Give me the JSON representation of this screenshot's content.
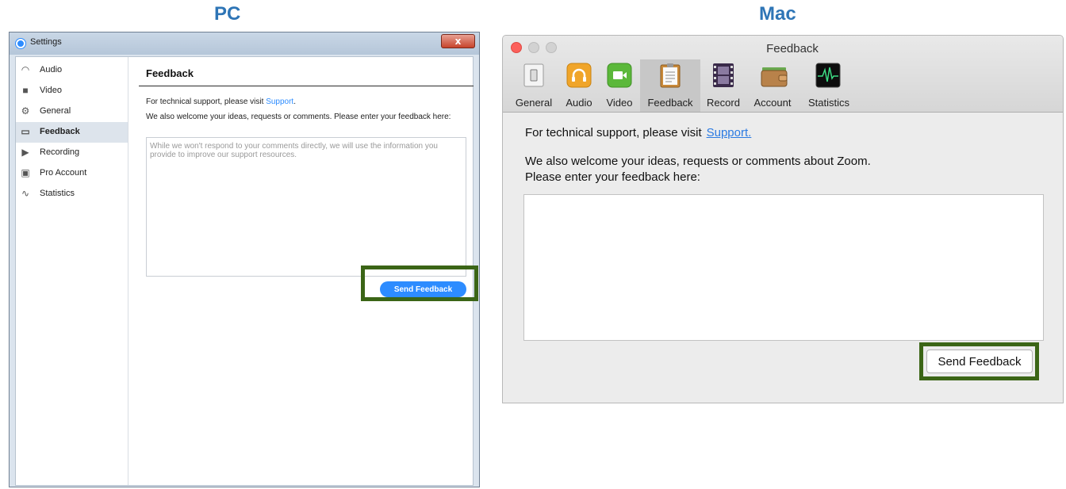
{
  "labels": {
    "pc": "PC",
    "mac": "Mac"
  },
  "pc": {
    "window_title": "Settings",
    "close_glyph": "x",
    "nav": [
      {
        "label": "Audio",
        "icon": "headphones-icon",
        "glyph": "◠"
      },
      {
        "label": "Video",
        "icon": "video-camera-icon",
        "glyph": "■"
      },
      {
        "label": "General",
        "icon": "gear-icon",
        "glyph": "⚙"
      },
      {
        "label": "Feedback",
        "icon": "chat-bubble-icon",
        "glyph": "▭"
      },
      {
        "label": "Recording",
        "icon": "play-box-icon",
        "glyph": "▶"
      },
      {
        "label": "Pro Account",
        "icon": "account-card-icon",
        "glyph": "▣"
      },
      {
        "label": "Statistics",
        "icon": "pulse-icon",
        "glyph": "∿"
      }
    ],
    "active_nav": "Feedback",
    "heading": "Feedback",
    "support_text": "For technical support, please visit ",
    "support_link": "Support",
    "support_period": ".",
    "welcome_text": "We also welcome your ideas, requests or comments. Please enter your feedback here:",
    "feedback_placeholder": "While we won't respond to your comments directly, we will use the information you provide to improve our support resources.",
    "send_label": "Send Feedback",
    "accent_color": "#2d8cff"
  },
  "mac": {
    "window_title": "Feedback",
    "tabs": [
      {
        "label": "General",
        "icon": "switch-icon"
      },
      {
        "label": "Audio",
        "icon": "headphones-icon"
      },
      {
        "label": "Video",
        "icon": "video-camera-icon"
      },
      {
        "label": "Feedback",
        "icon": "clipboard-icon"
      },
      {
        "label": "Record",
        "icon": "film-strip-icon"
      },
      {
        "label": "Account",
        "icon": "wallet-icon"
      },
      {
        "label": "Statistics",
        "icon": "pulse-monitor-icon"
      }
    ],
    "active_tab": "Feedback",
    "support_text": "For technical support, please visit",
    "support_link": "Support.",
    "welcome_line1": "We also welcome your ideas, requests or comments about Zoom.",
    "welcome_line2": "Please enter your feedback here:",
    "send_label": "Send Feedback"
  },
  "highlight_color": "#3b6516"
}
